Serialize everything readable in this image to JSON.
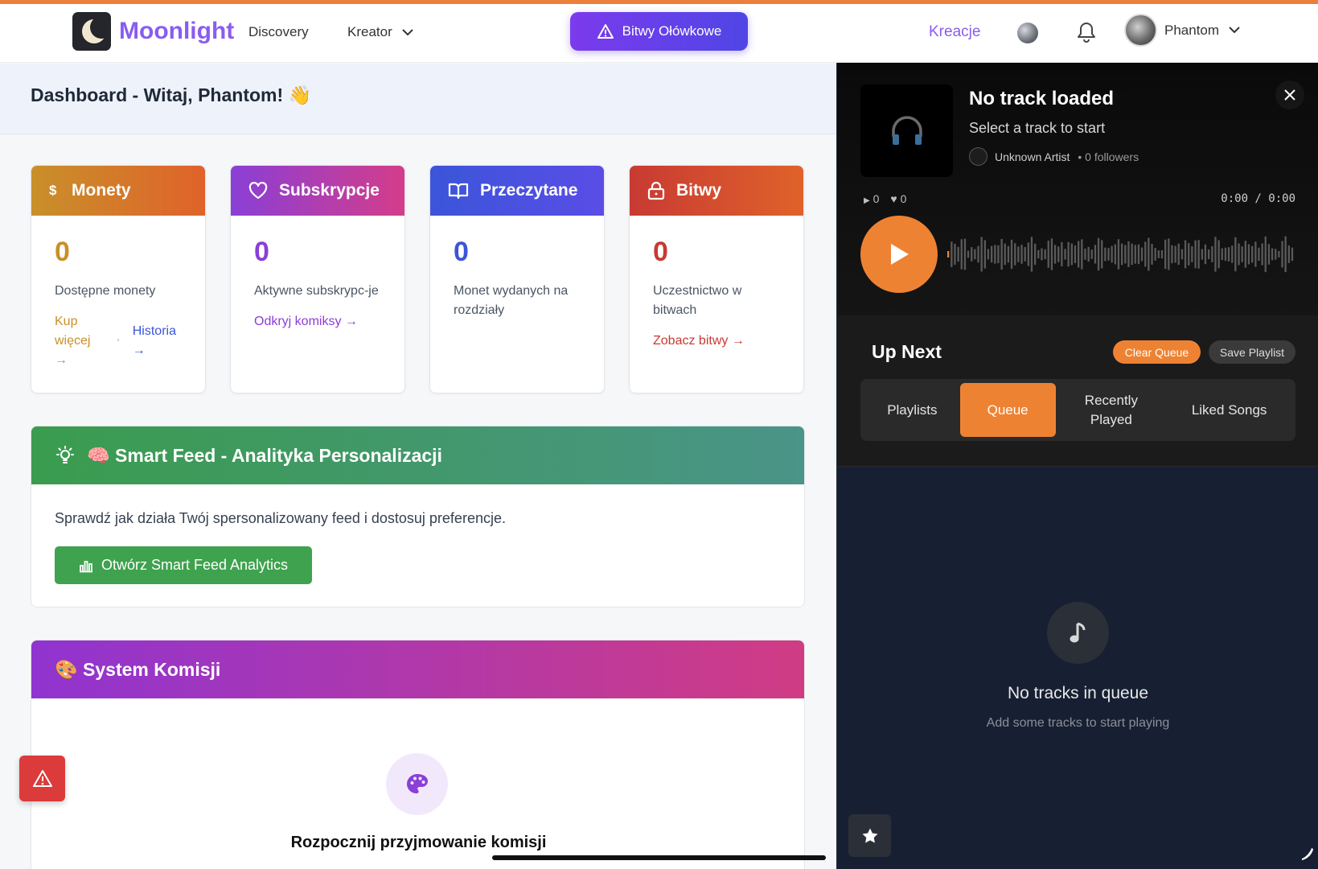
{
  "nav": {
    "brand": "Moonlight",
    "links": [
      "Discovery",
      "Kreator"
    ],
    "cta": "Bitwy Ołówkowe",
    "kreacje": "Kreacje",
    "user_name": "Phantom"
  },
  "dashboard": {
    "title": "Dashboard - Witaj, Phantom! 👋"
  },
  "stats": [
    {
      "title": "Monety",
      "value": "0",
      "desc": "Dostępne monety",
      "link1": "Kup więcej →",
      "link2": "Historia →",
      "color": "#c8902a"
    },
    {
      "title": "Subskrypcje",
      "value": "0",
      "desc": "Aktywne subskrypc-je",
      "link1": "Odkryj komiksy →",
      "color": "#8a3fd6"
    },
    {
      "title": "Przeczytane",
      "value": "0",
      "desc": "Monet wydanych na rozdziały",
      "color": "#3b55d9"
    },
    {
      "title": "Bitwy",
      "value": "0",
      "desc": "Uczestnictwo w bitwach",
      "link1": "Zobacz bitwy →",
      "color": "#c83a33"
    }
  ],
  "smart_feed": {
    "title": "🧠 Smart Feed - Analityka Personalizacji",
    "text": "Sprawdź jak działa Twój spersonalizowany feed i dostosuj preferencje.",
    "button": "Otwórz Smart Feed Analytics"
  },
  "komisje": {
    "title": "🎨 System Komisji",
    "subtitle": "Rozpocznij przyjmowanie komisji"
  },
  "player": {
    "track_title": "No track loaded",
    "track_sub": "Select a track to start",
    "artist": "Unknown Artist",
    "followers": "• 0 followers",
    "plays": "0",
    "likes": "0",
    "time": "0:00 / 0:00",
    "up_next": "Up Next",
    "clear_queue": "Clear Queue",
    "save_playlist": "Save Playlist",
    "tabs": [
      "Playlists",
      "Queue",
      "Recently Played",
      "Liked Songs"
    ],
    "active_tab": "Queue",
    "empty_title": "No tracks in queue",
    "empty_sub": "Add some tracks to start playing"
  },
  "colors": {
    "accent_orange": "#ee8233",
    "brand_purple": "#8a5cf0",
    "green": "#3fa24e"
  }
}
